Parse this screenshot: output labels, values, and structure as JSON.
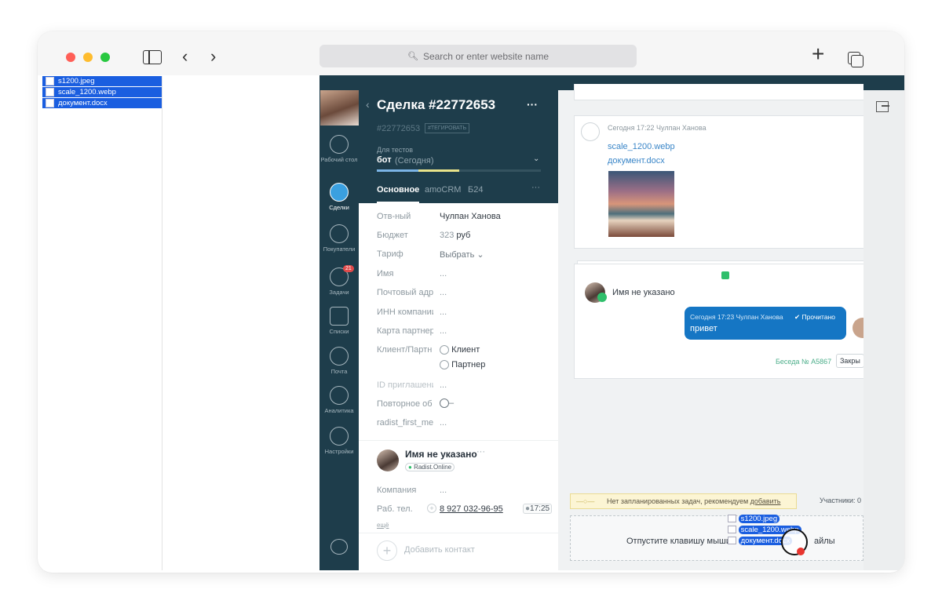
{
  "browser": {
    "address_placeholder": "Search or enter website name",
    "colors": {
      "close": "#ff5f57",
      "minimize": "#febc2e",
      "zoom": "#28c840"
    }
  },
  "finder": {
    "files": [
      {
        "name": "s1200.jpeg",
        "icon": "image-file-icon"
      },
      {
        "name": "scale_1200.webp",
        "icon": "document-file-icon"
      },
      {
        "name": "документ.docx",
        "icon": "word-file-icon"
      }
    ]
  },
  "nav": {
    "items": [
      {
        "label": "Рабочий стол",
        "icon": "dashboard-icon"
      },
      {
        "label": "Сделки",
        "icon": "deals-icon"
      },
      {
        "label": "Покупатели",
        "icon": "customers-icon"
      },
      {
        "label": "Задачи",
        "icon": "tasks-icon",
        "badge": "21"
      },
      {
        "label": "Списки",
        "icon": "lists-icon"
      },
      {
        "label": "Почта",
        "icon": "mail-icon"
      },
      {
        "label": "Аналитика",
        "icon": "analytics-icon"
      },
      {
        "label": "Настройки",
        "icon": "settings-icon"
      }
    ]
  },
  "deal": {
    "title": "Сделка #22772653",
    "more": "···",
    "id_tag": "#22772653",
    "tag_button": "#ТЕГИРОВАТЬ",
    "pipeline_label": "Для тестов",
    "stage": "бот",
    "stage_time": "(Сегодня)",
    "tabs": [
      "Основное",
      "amoCRM",
      "Б24"
    ],
    "fields": [
      {
        "label": "Отв-ный",
        "value": "Чулпан Ханова"
      },
      {
        "label": "Бюджет",
        "value_num": "323",
        "value": "руб"
      },
      {
        "label": "Тариф",
        "value": "Выбрать"
      },
      {
        "label": "Имя",
        "value": "..."
      },
      {
        "label": "Почтовый адр",
        "value": "..."
      },
      {
        "label": "ИНН компании",
        "value": "..."
      },
      {
        "label": "Карта партнера",
        "value": "..."
      },
      {
        "label": "Клиент/Партн",
        "option1": "Клиент",
        "option2": "Партнер"
      },
      {
        "label": "ID приглашения",
        "value": "..."
      },
      {
        "label": "Повторное об",
        "value": ""
      },
      {
        "label": "radist_first_me",
        "value": "..."
      }
    ],
    "contact": {
      "name": "Имя не указано",
      "source": "Radist.Online",
      "company_label": "Компания",
      "company_value": "...",
      "phone_label": "Раб. тел.",
      "phone": "8 927 032-96-95",
      "time": "17:25",
      "more_link": "ещё",
      "add_contact": "Добавить контакт"
    }
  },
  "feed": {
    "note": {
      "meta": "Сегодня 17:22 Чулпан Ханова",
      "file1": "scale_1200.webp",
      "file2": "документ.docx"
    },
    "chat": {
      "client_name": "Имя не указано",
      "message_meta": "Сегодня 17:23 Чулпан Ханова",
      "read_status": "Прочитано",
      "message": "привет",
      "conversation": "Беседа № A5867",
      "close_button": "Закры"
    },
    "task_warning": "Нет запланированных задач, рекомендуем",
    "task_add": "добавить",
    "participants": "Участники: 0",
    "drop_text_left": "Отпустите клавишу мыши",
    "drop_text_right": "айлы",
    "drag_files": [
      "s1200.jpeg",
      "scale_1200.webp",
      "документ.docx"
    ]
  }
}
